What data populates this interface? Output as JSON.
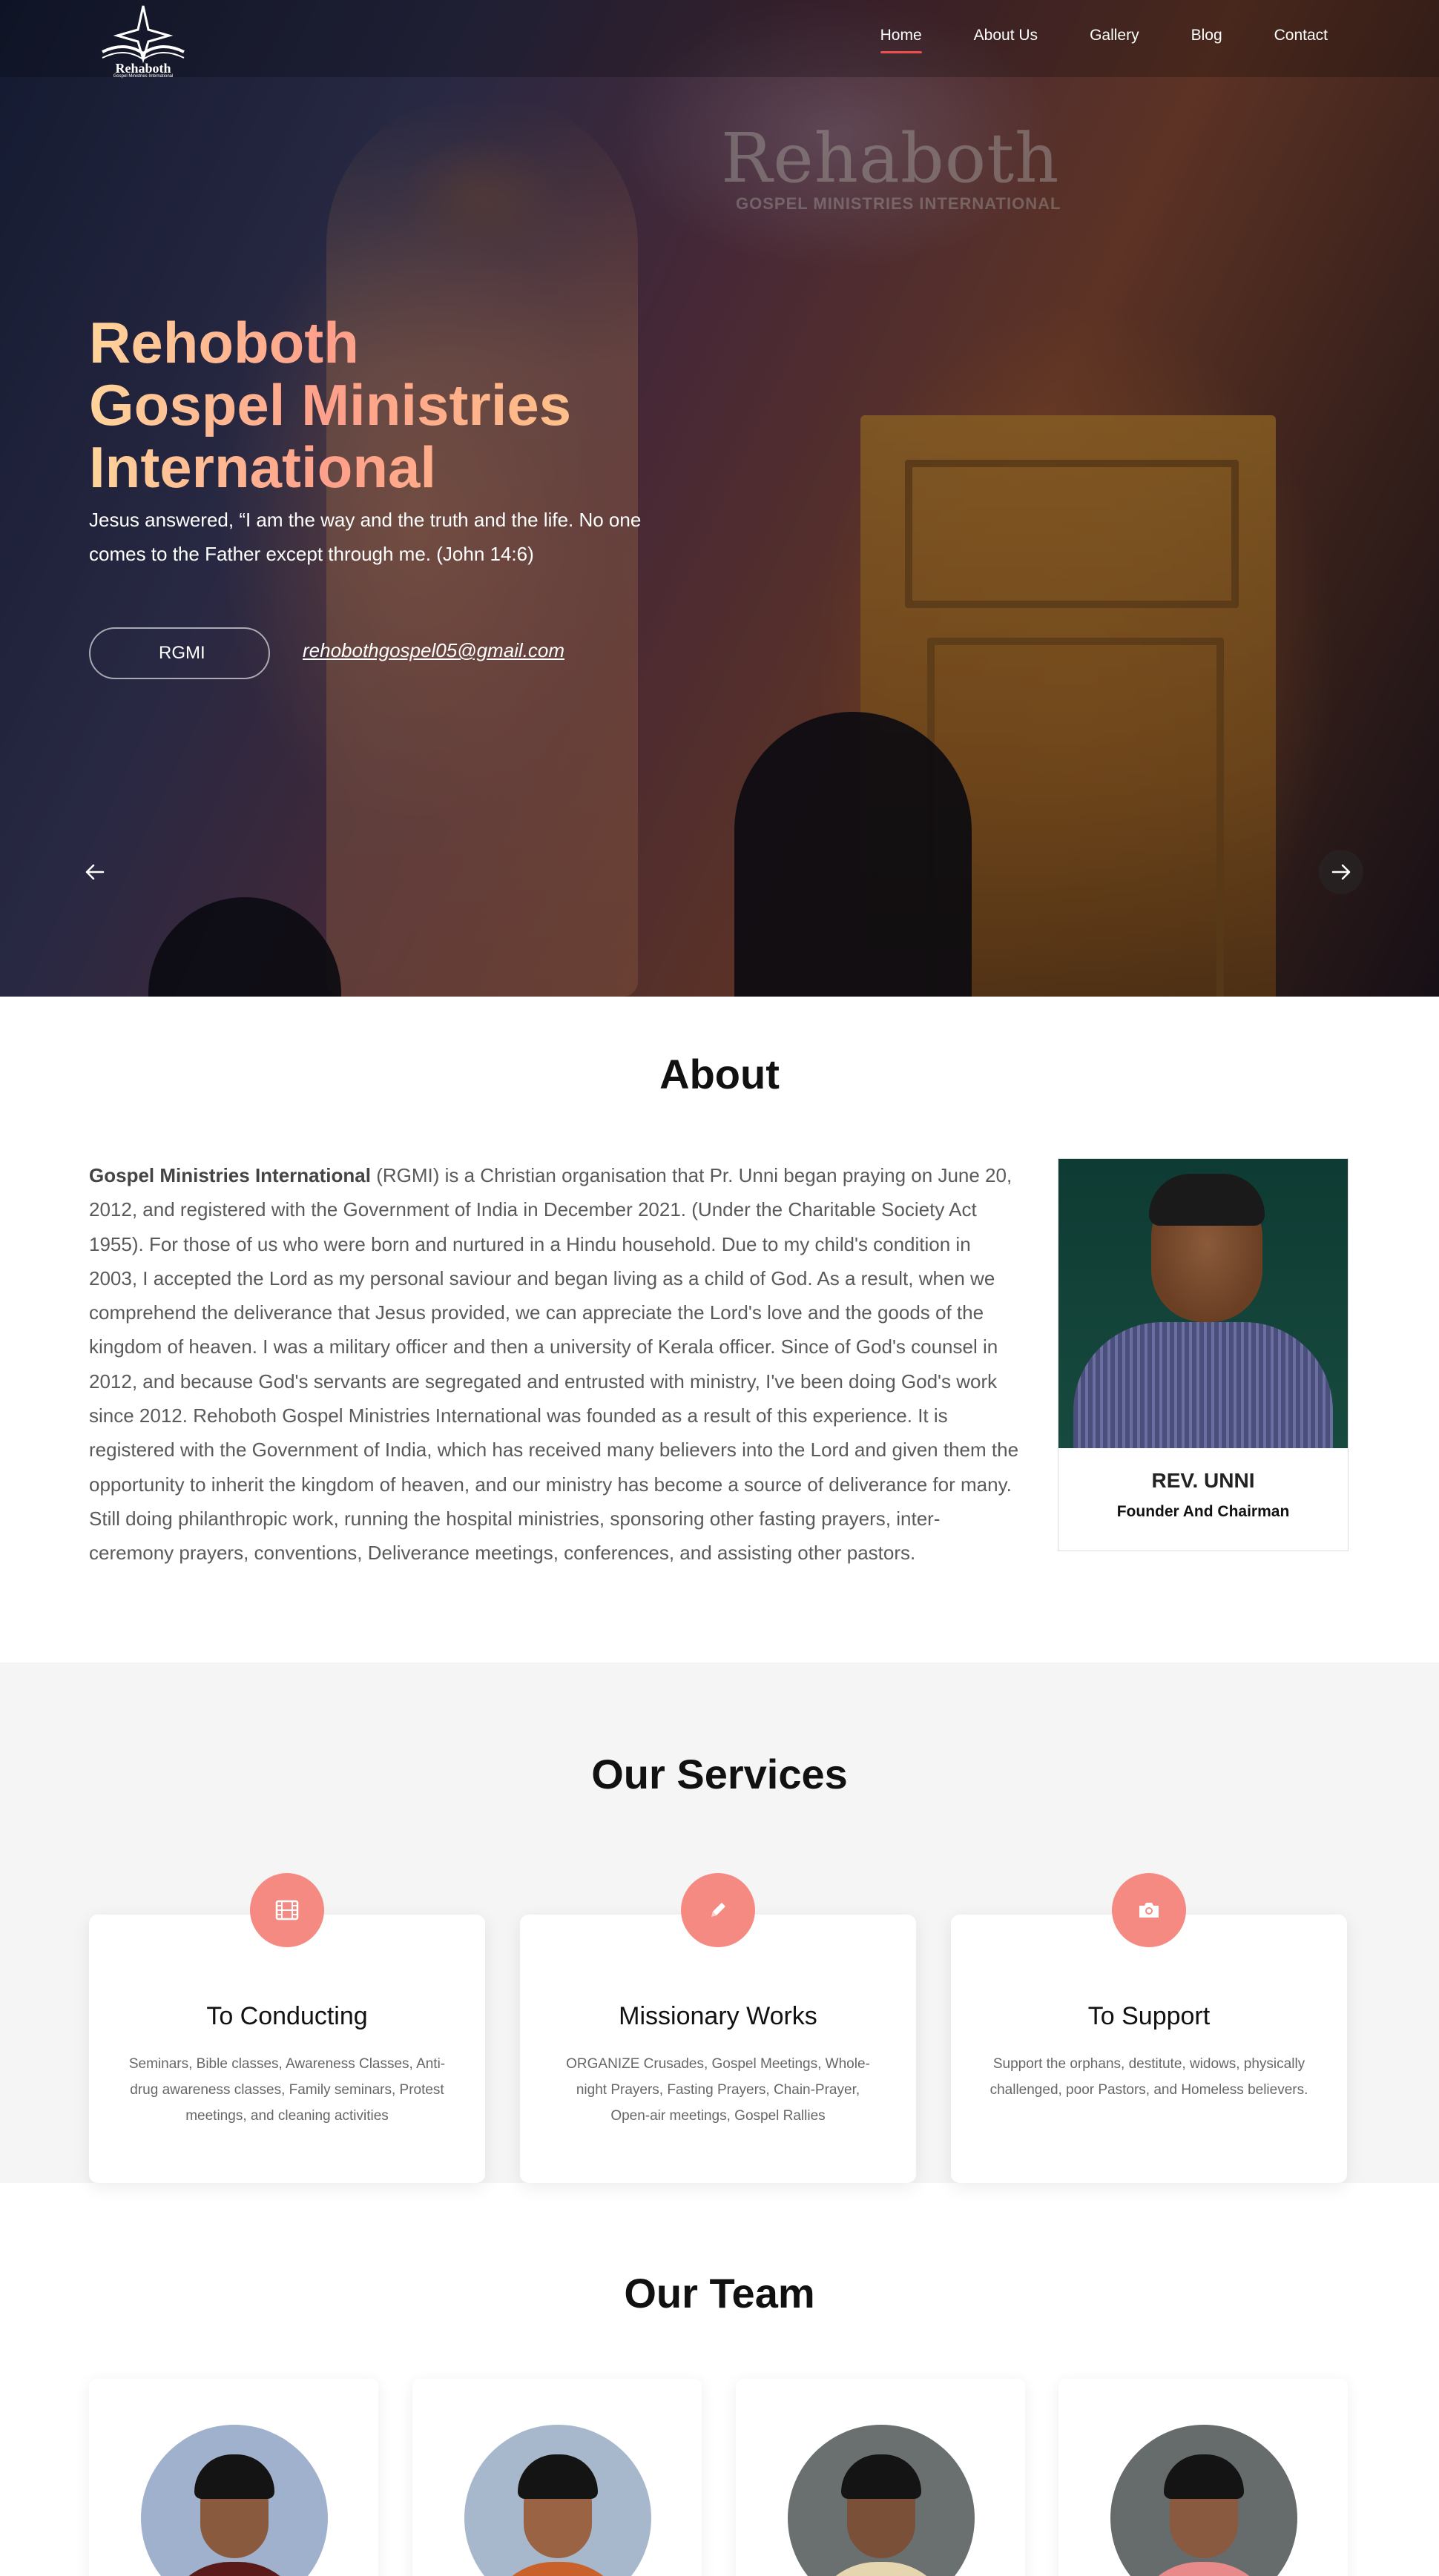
{
  "nav": {
    "logo_text": "Rehaboth",
    "logo_tagline": "Gospel Ministries International",
    "items": [
      {
        "label": "Home",
        "active": true
      },
      {
        "label": "About Us",
        "active": false
      },
      {
        "label": "Gallery",
        "active": false
      },
      {
        "label": "Blog",
        "active": false
      },
      {
        "label": "Contact",
        "active": false
      }
    ]
  },
  "hero": {
    "backdrop_title": "Rehaboth",
    "backdrop_subtitle": "GOSPEL MINISTRIES INTERNATIONAL",
    "title_lines": [
      "Rehoboth",
      "Gospel Ministries",
      "International"
    ],
    "verse": "Jesus answered, “I am the way and the truth and the life. No one comes to the Father except through me. (John 14:6)",
    "button_label": "RGMI",
    "email": "rehobothgospel05@gmail.com",
    "prev_icon": "arrow-left-icon",
    "next_icon": "arrow-right-icon",
    "title_gradient": [
      "#ffd49a",
      "#ff9f8a",
      "#ffc08a"
    ]
  },
  "about": {
    "title": "About",
    "lead_bold": "Gospel Ministries International",
    "body": " (RGMI) is a Christian organisation that Pr. Unni began praying on June 20, 2012, and registered with the Government of India in December 2021. (Under the Charitable Society Act 1955). For those of us who were born and nurtured in a Hindu household. Due to my child's condition in 2003, I accepted the Lord as my personal saviour and began living as a child of God. As a result, when we comprehend the deliverance that Jesus provided, we can appreciate the Lord's love and the goods of the kingdom of heaven. I was a military officer and then a university of Kerala officer. Since of God's counsel in 2012, and because God's servants are segregated and entrusted with ministry, I've been doing God's work since 2012. Rehoboth Gospel Ministries International was founded as a result of this experience. It is registered with the Government of India, which has received many believers into the Lord and given them the opportunity to inherit the kingdom of heaven, and our ministry has become a source of deliverance for many. Still doing philanthropic work, running the hospital ministries, sponsoring other fasting prayers, inter-ceremony prayers, conventions, Deliverance meetings, conferences, and assisting other pastors.",
    "profile": {
      "name": "REV. UNNI",
      "role": "Founder And Chairman"
    }
  },
  "services": {
    "title": "Our Services",
    "accent_color": "#f58a82",
    "items": [
      {
        "icon": "film-icon",
        "title": "To Conducting",
        "desc": "Seminars, Bible classes, Awareness Classes, Anti-drug awareness classes, Family seminars, Protest meetings, and cleaning activities"
      },
      {
        "icon": "pencil-icon",
        "title": "Missionary Works",
        "desc": "ORGANIZE Crusades, Gospel Meetings, Whole-night Prayers, Fasting Prayers, Chain-Prayer, Open-air meetings, Gospel Rallies"
      },
      {
        "icon": "camera-icon",
        "title": "To Support",
        "desc": "Support the orphans, destitute, widows, physically challenged, poor Pastors, and Homeless believers."
      }
    ]
  },
  "team": {
    "title": "Our Team",
    "members": [
      {
        "photo": "team-member-photo-1"
      },
      {
        "photo": "team-member-photo-2"
      },
      {
        "photo": "team-member-photo-3"
      },
      {
        "photo": "team-member-photo-4"
      }
    ]
  }
}
